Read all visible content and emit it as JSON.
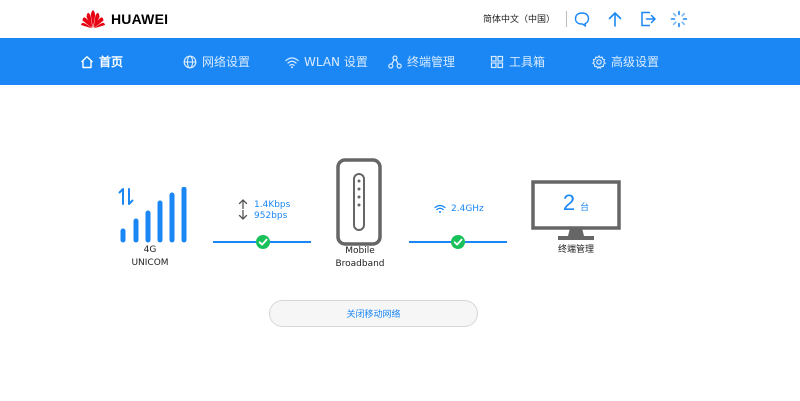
{
  "header": {
    "brand": "HUAWEI",
    "language": "简体中文（中国）",
    "icons": [
      "chat-icon",
      "upload-icon",
      "logout-icon",
      "loading-icon"
    ]
  },
  "nav": {
    "items": [
      {
        "label": "首页",
        "icon": "home-icon"
      },
      {
        "label": "网络设置",
        "icon": "globe-icon"
      },
      {
        "label": "WLAN 设置",
        "icon": "wifi-icon"
      },
      {
        "label": "终端管理",
        "icon": "network-icon"
      },
      {
        "label": "工具箱",
        "icon": "grid-icon"
      },
      {
        "label": "高级设置",
        "icon": "gear-icon"
      }
    ]
  },
  "status": {
    "network_type": "4G",
    "carrier": "UNICOM",
    "upload_rate": "1.4Kbps",
    "download_rate": "952bps",
    "device_label": "Mobile Broadband",
    "wifi_band": "2.4GHz",
    "device_count": "2",
    "device_count_unit": "台",
    "device_mgmt_label": "终端管理"
  },
  "actions": {
    "toggle_mobile_data": "关闭移动网络"
  },
  "colors": {
    "accent": "#1a87f5",
    "ok": "#19c15a",
    "device_gray": "#666666"
  }
}
